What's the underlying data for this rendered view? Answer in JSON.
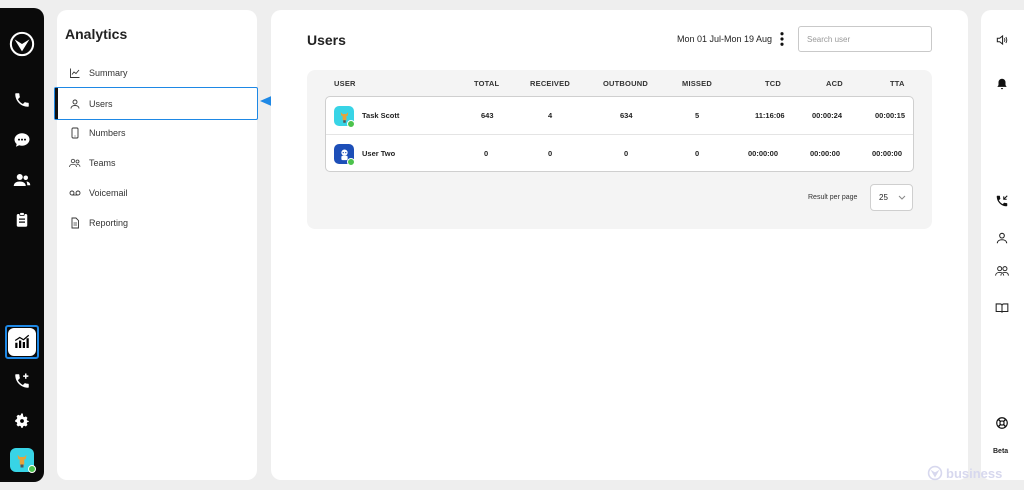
{
  "sidebar": {
    "title": "Analytics",
    "items": [
      {
        "label": "Summary",
        "icon": "chart-line-icon"
      },
      {
        "label": "Users",
        "icon": "user-icon",
        "active": true
      },
      {
        "label": "Numbers",
        "icon": "phone-device-icon"
      },
      {
        "label": "Teams",
        "icon": "team-icon"
      },
      {
        "label": "Voicemail",
        "icon": "voicemail-icon"
      },
      {
        "label": "Reporting",
        "icon": "document-icon"
      }
    ]
  },
  "main": {
    "title": "Users",
    "date_range": "Mon 01 Jul-Mon 19 Aug",
    "search_placeholder": "Search user",
    "columns": [
      "USER",
      "TOTAL",
      "RECEIVED",
      "OUTBOUND",
      "MISSED",
      "TCD",
      "ACD",
      "TTA"
    ],
    "rows": [
      {
        "user": "Task Scott",
        "total": "643",
        "received": "4",
        "outbound": "634",
        "missed": "5",
        "tcd": "11:16:06",
        "acd": "00:00:24",
        "tta": "00:00:15"
      },
      {
        "user": "User Two",
        "total": "0",
        "received": "0",
        "outbound": "0",
        "missed": "0",
        "tcd": "00:00:00",
        "acd": "00:00:00",
        "tta": "00:00:00"
      }
    ],
    "pagination": {
      "label": "Result per page",
      "value": "25"
    }
  },
  "right_rail": {
    "beta_label": "Beta"
  },
  "brand": {
    "text": "business"
  },
  "colors": {
    "accent": "#1e88e5",
    "rail": "#0a0a0a",
    "status": "#4cc34c",
    "avatar": "#38d4e6"
  }
}
